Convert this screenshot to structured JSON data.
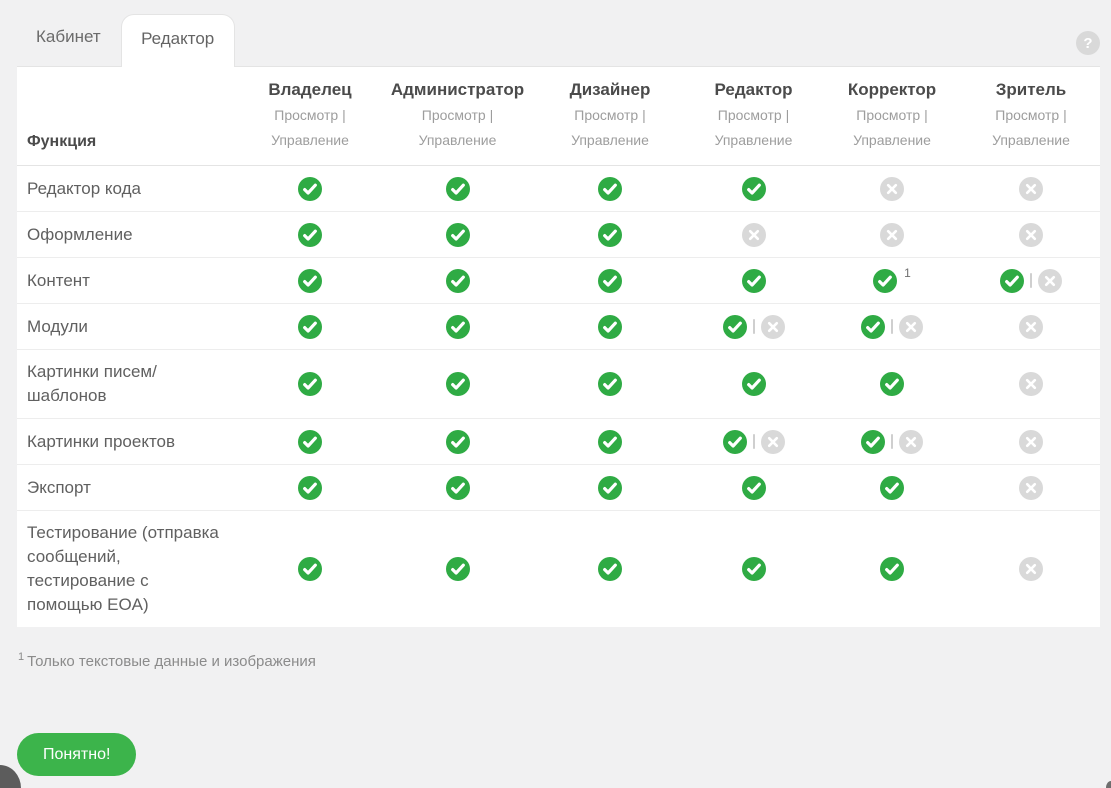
{
  "tabs": [
    {
      "label": "Кабинет",
      "active": false
    },
    {
      "label": "Редактор",
      "active": true
    }
  ],
  "help": {
    "glyph": "?"
  },
  "table": {
    "function_header": "Функция",
    "sub_header_text": "Просмотр |\nУправление",
    "roles": [
      "Владелец",
      "Администратор",
      "Дизайнер",
      "Редактор",
      "Корректор",
      "Зритель"
    ],
    "rows": [
      {
        "label": "Редактор кода",
        "cells": [
          "yes",
          "yes",
          "yes",
          "yes",
          "no",
          "no"
        ]
      },
      {
        "label": "Оформление",
        "cells": [
          "yes",
          "yes",
          "yes",
          "no",
          "no",
          "no"
        ]
      },
      {
        "label": "Контент",
        "cells": [
          "yes",
          "yes",
          "yes",
          "yes",
          "yes1",
          "yes|no"
        ]
      },
      {
        "label": "Модули",
        "cells": [
          "yes",
          "yes",
          "yes",
          "yes|no",
          "yes|no",
          "no"
        ]
      },
      {
        "label": "Картинки писем/\nшаблонов",
        "cells": [
          "yes",
          "yes",
          "yes",
          "yes",
          "yes",
          "no"
        ]
      },
      {
        "label": "Картинки проектов",
        "cells": [
          "yes",
          "yes",
          "yes",
          "yes|no",
          "yes|no",
          "no"
        ]
      },
      {
        "label": "Экспорт",
        "cells": [
          "yes",
          "yes",
          "yes",
          "yes",
          "yes",
          "no"
        ]
      },
      {
        "label": "Тестирование (отправка\nсообщений,\nтестирование с\nпомощью EOA)",
        "cells": [
          "yes",
          "yes",
          "yes",
          "yes",
          "yes",
          "no"
        ]
      }
    ],
    "footnote": {
      "sup": "1",
      "text": "Только текстовые данные и изображения"
    }
  },
  "button": {
    "label": "Понятно!"
  },
  "colors": {
    "check_green": "#2fab44",
    "cross_gray": "#d9d9d9",
    "button_green": "#3cb44b",
    "page_bg": "#f1f1f2"
  }
}
